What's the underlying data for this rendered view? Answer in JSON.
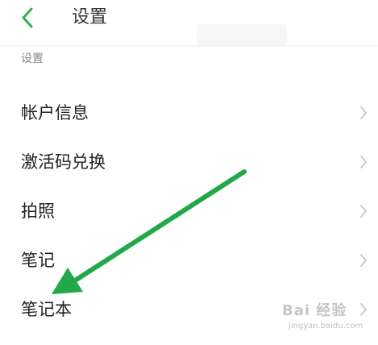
{
  "header": {
    "back_icon": "chevron-left-icon",
    "title": "设置"
  },
  "section": {
    "label": "设置"
  },
  "menu": {
    "items": [
      {
        "label": "帐户信息",
        "icon": "chevron-right-icon"
      },
      {
        "label": "激活码兑换",
        "icon": "chevron-right-icon"
      },
      {
        "label": "拍照",
        "icon": "chevron-right-icon"
      },
      {
        "label": "笔记",
        "icon": "chevron-right-icon"
      },
      {
        "label": "笔记本",
        "icon": "chevron-right-icon"
      }
    ]
  },
  "annotation": {
    "icon": "arrow-pointer-icon",
    "color": "#22a84a"
  },
  "watermark": {
    "logo": "Bai 经验",
    "url": "jingyan.baidu.com"
  },
  "colors": {
    "accent": "#2db34a",
    "text": "#222222",
    "muted": "#8a8a8a",
    "chevron": "#c8c8c8"
  }
}
